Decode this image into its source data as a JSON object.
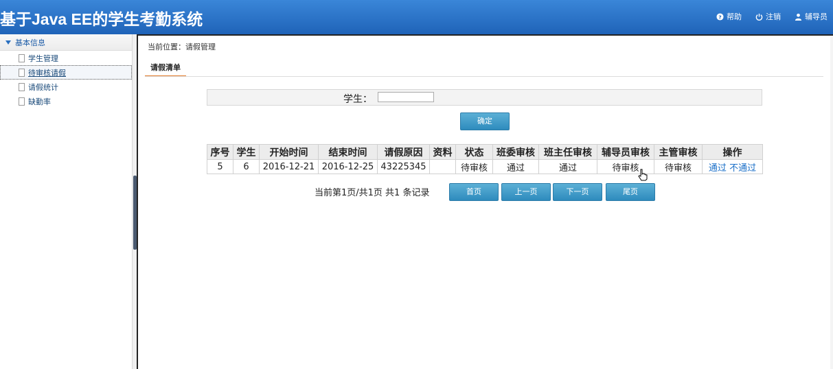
{
  "header": {
    "title": "基于Java EE的学生考勤系统",
    "links": [
      {
        "label": "帮助",
        "icon": "help-icon"
      },
      {
        "label": "注销",
        "icon": "power-icon"
      },
      {
        "label": "辅导员",
        "icon": "user-icon"
      }
    ]
  },
  "sidebar": {
    "section": "基本信息",
    "items": [
      {
        "label": "学生管理"
      },
      {
        "label": "待审核请假"
      },
      {
        "label": "请假统计"
      },
      {
        "label": "缺勤率"
      }
    ],
    "active_index": 1
  },
  "main": {
    "breadcrumb": "当前位置：请假管理",
    "tab": "请假清单",
    "search": {
      "label": "学生：",
      "value": "",
      "button": "确定"
    },
    "table": {
      "headers": [
        "序号",
        "学生",
        "开始时间",
        "结束时间",
        "请假原因",
        "资料",
        "状态",
        "班委审核",
        "班主任审核",
        "辅导员审核",
        "主管审核",
        "操作"
      ],
      "rows": [
        {
          "id": "5",
          "student": "6",
          "start": "2016-12-21",
          "end": "2016-12-25",
          "reason": "43225345",
          "material": "",
          "status": "待审核",
          "monitor_review": "通过",
          "headteacher_review": "通过",
          "counselor_review": "待审核",
          "supervisor_review": "待审核",
          "action_pass": "通过",
          "action_reject": "不通过"
        }
      ]
    },
    "pager": {
      "text": "当前第1页/共1页  共1 条记录",
      "first": "首页",
      "prev": "上一页",
      "next": "下一页",
      "last": "尾页"
    }
  },
  "colors": {
    "header_top": "#3a86d8",
    "header_bottom": "#1f63b8",
    "button": "#3a97c6",
    "link": "#1a6fc8",
    "tab_underline": "#e27a2a"
  }
}
